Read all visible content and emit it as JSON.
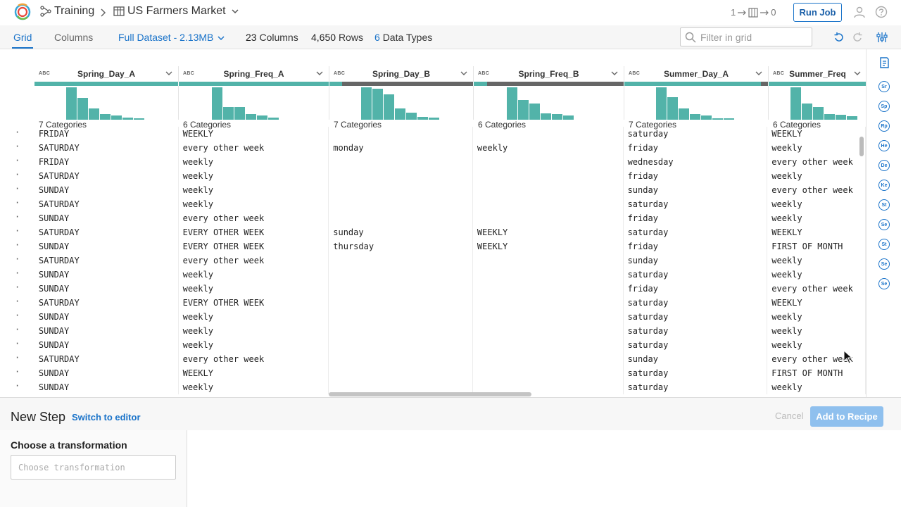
{
  "header": {
    "flow_name": "Training",
    "dataset_name": "US Farmers Market",
    "flow_counts": {
      "left": "1",
      "right": "0"
    },
    "run_job_label": "Run Job"
  },
  "tabs": [
    {
      "label": "Grid",
      "active": true
    },
    {
      "label": "Columns",
      "active": false
    }
  ],
  "dataset_selector": "Full Dataset - 2.13MB",
  "stats": {
    "columns_count": "23",
    "columns_label": "Columns",
    "rows_count": "4,650",
    "rows_label": "Rows",
    "types_count": "6",
    "types_label": "Data Types"
  },
  "filter": {
    "placeholder": "Filter in grid"
  },
  "columns": [
    {
      "name": "Spring_Day_A",
      "type": "ABC",
      "categories": "7 Categories",
      "hist": [
        1.0,
        0.68,
        0.35,
        0.18,
        0.12,
        0.06,
        0.05
      ],
      "missing": 0
    },
    {
      "name": "Spring_Freq_A",
      "type": "ABC",
      "categories": "6 Categories",
      "hist": [
        1.0,
        0.4,
        0.4,
        0.17,
        0.12,
        0.07
      ],
      "missing": 0
    },
    {
      "name": "Spring_Day_B",
      "type": "ABC",
      "categories": "7 Categories",
      "hist": [
        1.0,
        0.95,
        0.78,
        0.35,
        0.22,
        0.08,
        0.07
      ],
      "missing": 0.9
    },
    {
      "name": "Spring_Freq_B",
      "type": "ABC",
      "categories": "6 Categories",
      "hist": [
        1.0,
        0.6,
        0.5,
        0.2,
        0.18,
        0.13
      ],
      "missing": 0.9
    },
    {
      "name": "Summer_Day_A",
      "type": "ABC",
      "categories": "7 Categories",
      "hist": [
        1.0,
        0.7,
        0.35,
        0.18,
        0.12,
        0.05,
        0.04
      ],
      "missing": 0.05
    },
    {
      "name": "Summer_Freq",
      "type": "ABC",
      "categories": "6 Categories",
      "hist": [
        1.0,
        0.5,
        0.4,
        0.18,
        0.15,
        0.1
      ],
      "missing": 0
    }
  ],
  "rows": [
    [
      "FRIDAY",
      "WEEKLY",
      "",
      "",
      "saturday",
      "WEEKLY"
    ],
    [
      "SATURDAY",
      "every other week",
      "monday",
      "weekly",
      "friday",
      "weekly"
    ],
    [
      "FRIDAY",
      "weekly",
      "",
      "",
      "wednesday",
      "every other week"
    ],
    [
      "SATURDAY",
      "weekly",
      "",
      "",
      "friday",
      "weekly"
    ],
    [
      "SUNDAY",
      "weekly",
      "",
      "",
      "sunday",
      "every other week"
    ],
    [
      "SATURDAY",
      "weekly",
      "",
      "",
      "saturday",
      "weekly"
    ],
    [
      "SUNDAY",
      "every other week",
      "",
      "",
      "friday",
      "weekly"
    ],
    [
      "SATURDAY",
      "EVERY OTHER WEEK",
      "sunday",
      "WEEKLY",
      "saturday",
      "WEEKLY"
    ],
    [
      "SUNDAY",
      "EVERY OTHER WEEK",
      "thursday",
      "WEEKLY",
      "friday",
      "FIRST OF MONTH"
    ],
    [
      "SATURDAY",
      "every other week",
      "",
      "",
      "sunday",
      "weekly"
    ],
    [
      "SUNDAY",
      "weekly",
      "",
      "",
      "saturday",
      "weekly"
    ],
    [
      "SUNDAY",
      "weekly",
      "",
      "",
      "friday",
      "every other week"
    ],
    [
      "SATURDAY",
      "EVERY OTHER WEEK",
      "",
      "",
      "saturday",
      "WEEKLY"
    ],
    [
      "SUNDAY",
      "weekly",
      "",
      "",
      "saturday",
      "weekly"
    ],
    [
      "SUNDAY",
      "weekly",
      "",
      "",
      "saturday",
      "weekly"
    ],
    [
      "SUNDAY",
      "weekly",
      "",
      "",
      "saturday",
      "weekly"
    ],
    [
      "SATURDAY",
      "every other week",
      "",
      "",
      "sunday",
      "every other week"
    ],
    [
      "SUNDAY",
      "WEEKLY",
      "",
      "",
      "saturday",
      "FIRST OF MONTH"
    ],
    [
      "SUNDAY",
      "weekly",
      "",
      "",
      "saturday",
      "weekly"
    ]
  ],
  "right_panel_badges": [
    "Sr",
    "Sp",
    "Rp",
    "He",
    "De",
    "Ke",
    "St",
    "Se",
    "St",
    "Se",
    "Se"
  ],
  "bottom": {
    "title": "New Step",
    "switch_label": "Switch to editor",
    "cancel_label": "Cancel",
    "add_label": "Add to Recipe",
    "choose_label": "Choose a transformation",
    "choose_placeholder": "Choose transformation"
  },
  "colors": {
    "accent": "#1a73c9",
    "histogram": "#52b3a9",
    "missing": "#666666"
  }
}
